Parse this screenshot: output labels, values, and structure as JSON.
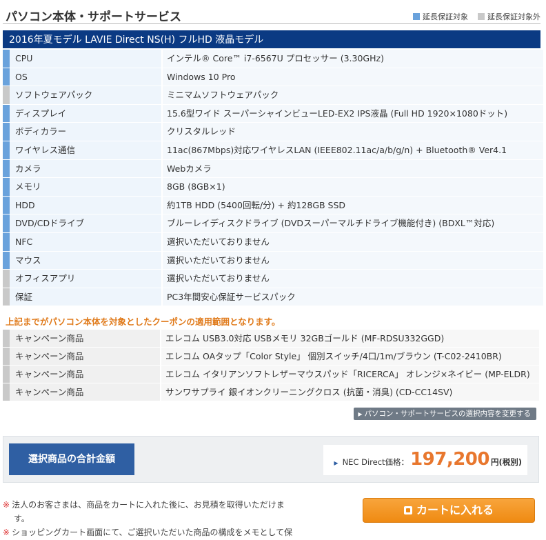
{
  "header": {
    "title": "パソコン本体・サポートサービス",
    "legend_covered": "延長保証対象",
    "legend_not_covered": "延長保証対象外",
    "colors": {
      "covered": "#6aa2dc",
      "not_covered": "#c9c9c9"
    }
  },
  "model": {
    "name": "2016年夏モデル LAVIE Direct NS(H) フルHD 液晶モデル"
  },
  "specs": [
    {
      "label": "CPU",
      "value": "インテル® Core™ i7-6567U プロセッサー (3.30GHz)",
      "covered": true
    },
    {
      "label": "OS",
      "value": "Windows 10 Pro",
      "covered": true
    },
    {
      "label": "ソフトウェアパック",
      "value": "ミニマムソフトウェアパック",
      "covered": false
    },
    {
      "label": "ディスプレイ",
      "value": "15.6型ワイド スーパーシャインビューLED-EX2 IPS液晶 (Full HD 1920×1080ドット)",
      "covered": true
    },
    {
      "label": "ボディカラー",
      "value": "クリスタルレッド",
      "covered": true
    },
    {
      "label": "ワイヤレス通信",
      "value": "11ac(867Mbps)対応ワイヤレスLAN (IEEE802.11ac/a/b/g/n) + Bluetooth® Ver4.1",
      "covered": true
    },
    {
      "label": "カメラ",
      "value": "Webカメラ",
      "covered": true
    },
    {
      "label": "メモリ",
      "value": "8GB (8GB×1)",
      "covered": true
    },
    {
      "label": "HDD",
      "value": "約1TB HDD (5400回転/分) + 約128GB SSD",
      "covered": true
    },
    {
      "label": "DVD/CDドライブ",
      "value": "ブルーレイディスクドライブ (DVDスーパーマルチドライブ機能付き) (BDXL™対応)",
      "covered": true
    },
    {
      "label": "NFC",
      "value": "選択いただいておりません",
      "covered": true
    },
    {
      "label": "マウス",
      "value": "選択いただいておりません",
      "covered": true
    },
    {
      "label": "オフィスアプリ",
      "value": "選択いただいておりません",
      "covered": false
    },
    {
      "label": "保証",
      "value": "PC3年間安心保証サービスパック",
      "covered": false
    }
  ],
  "coupon_note": "上記までがパソコン本体を対象としたクーポンの適用範囲となります。",
  "campaign": [
    {
      "label": "キャンペーン商品",
      "value": "エレコム USB3.0対応 USBメモリ 32GBゴールド (MF-RDSU332GGD)"
    },
    {
      "label": "キャンペーン商品",
      "value": "エレコム OAタップ「Color Style」 個別スイッチ/4口/1m/ブラウン (T-C02-2410BR)"
    },
    {
      "label": "キャンペーン商品",
      "value": "エレコム イタリアンソフトレザーマウスパッド「RICERCA」 オレンジ×ネイビー (MP-ELDR)"
    },
    {
      "label": "キャンペーン商品",
      "value": "サンワサプライ 銀イオンクリーニングクロス (抗菌・消臭) (CD-CC14SV)"
    }
  ],
  "change_button": "パソコン・サポートサービスの選択内容を変更する",
  "total": {
    "label": "選択商品の合計金額",
    "price_prefix": "NEC Direct価格：",
    "price": "197,200",
    "price_suffix": "円(税別)"
  },
  "notes": [
    "法人のお客さまは、商品をカートに入れた後に、お見積を取得いただけます。",
    "ショッピングカート画面にて、ご選択いただいた商品の構成をメモとして保存"
  ],
  "cart_button": "カートに入れる"
}
